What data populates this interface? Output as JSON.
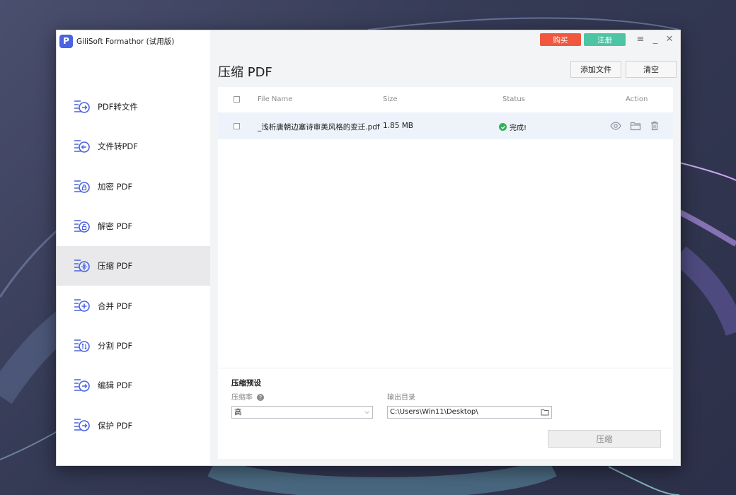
{
  "app": {
    "title": "GiliSoft Formathor (试用版)",
    "logo_letter": "P"
  },
  "titlebar": {
    "buy_label": "购买",
    "register_label": "注册",
    "menu_icon": "≡",
    "minimize_icon": "_",
    "close_icon": "✕"
  },
  "sidebar": {
    "items": [
      {
        "label": "PDF转文件",
        "icon": "pdf-to-file-icon",
        "active": false
      },
      {
        "label": "文件转PDF",
        "icon": "file-to-pdf-icon",
        "active": false
      },
      {
        "label": "加密 PDF",
        "icon": "encrypt-pdf-icon",
        "active": false
      },
      {
        "label": "解密 PDF",
        "icon": "decrypt-pdf-icon",
        "active": false
      },
      {
        "label": "压缩 PDF",
        "icon": "compress-pdf-icon",
        "active": true
      },
      {
        "label": "合并 PDF",
        "icon": "merge-pdf-icon",
        "active": false
      },
      {
        "label": "分割 PDF",
        "icon": "split-pdf-icon",
        "active": false
      },
      {
        "label": "编辑 PDF",
        "icon": "edit-pdf-icon",
        "active": false
      },
      {
        "label": "保护 PDF",
        "icon": "protect-pdf-icon",
        "active": false
      }
    ]
  },
  "main": {
    "title": "压缩 PDF",
    "add_file_label": "添加文件",
    "clear_label": "清空",
    "table": {
      "headers": {
        "file_name": "File Name",
        "size": "Size",
        "status": "Status",
        "action": "Action"
      },
      "rows": [
        {
          "file_name": "_浅析唐朝边塞诗审美风格的变迁.pdf",
          "size": "1.85 MB",
          "status": "完成!"
        }
      ]
    },
    "settings": {
      "title": "压缩预设",
      "rate_label": "压缩率",
      "rate_value": "高",
      "output_label": "输出目录",
      "output_path": "C:\\Users\\Win11\\Desktop\\",
      "compress_label": "压缩"
    }
  },
  "colors": {
    "accent": "#4b63e0",
    "buy": "#f0573e",
    "register": "#4dc4a4",
    "success": "#2db35a"
  }
}
